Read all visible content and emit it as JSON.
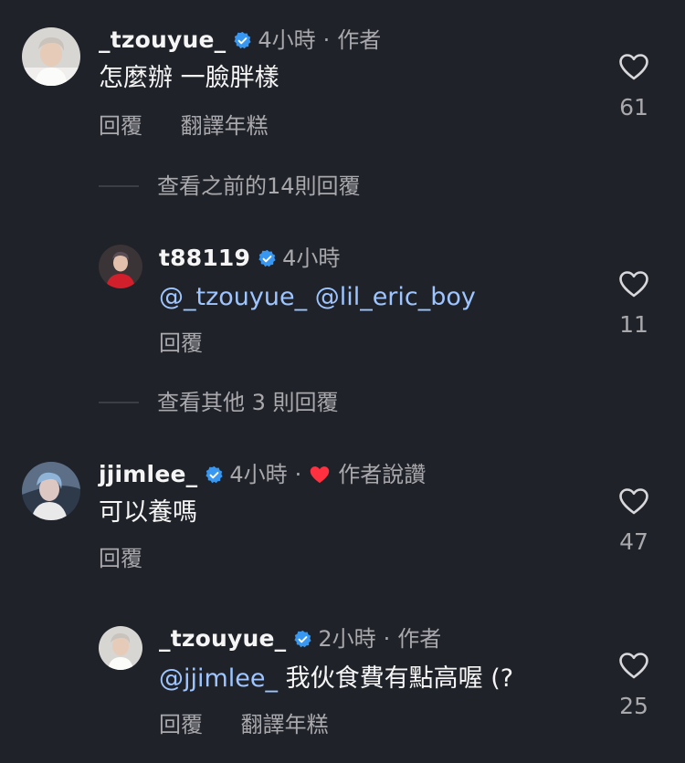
{
  "comments": [
    {
      "username": "_tzouyue_",
      "time": "4小時",
      "tag": "作者",
      "text": "怎麼辦 一臉胖樣",
      "actions": [
        "回覆",
        "翻譯年糕"
      ],
      "likes": "61"
    },
    {
      "username": "t88119",
      "time": "4小時",
      "mention1": "@_tzouyue_",
      "mention2": "@lil_eric_boy",
      "actions": [
        "回覆"
      ],
      "likes": "11"
    },
    {
      "username": "jjimlee_",
      "time": "4小時",
      "tag": "作者說讚",
      "text": "可以養嗎",
      "actions": [
        "回覆"
      ],
      "likes": "47"
    },
    {
      "username": "_tzouyue_",
      "time": "2小時",
      "tag": "作者",
      "mention": "@jjimlee_",
      "text": "我伙食費有點高喔 (?",
      "actions": [
        "回覆",
        "翻譯年糕"
      ],
      "likes": "25"
    }
  ],
  "view_more": [
    "查看之前的14則回覆",
    "查看其他 3 則回覆"
  ],
  "dot": "·",
  "colors": {
    "background": "#1f2228",
    "verified": "#3897f0",
    "mention": "#9ec5ff",
    "heart_red": "#ff3040",
    "muted": "#a8a8ad"
  },
  "icons": [
    "verified-badge-icon",
    "heart-outline-icon",
    "heart-filled-icon"
  ]
}
